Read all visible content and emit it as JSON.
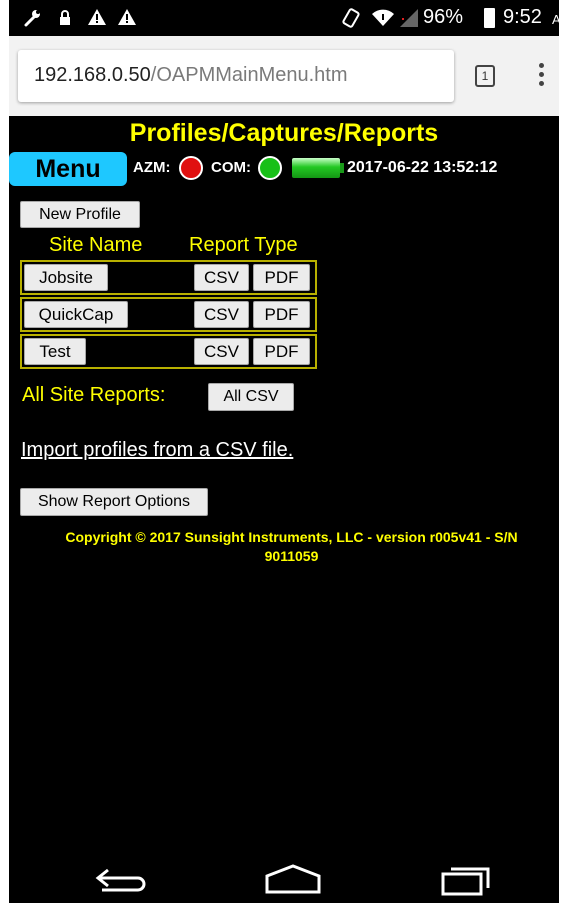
{
  "status_bar": {
    "battery_percent": "96%",
    "time": "9:52",
    "time_suffix": "AM"
  },
  "browser": {
    "url_host": "192.168.0.50",
    "url_path": "/OAPMMainMenu.htm",
    "tab_count": "1"
  },
  "page": {
    "title": "Profiles/Captures/Reports",
    "menu_label": "Menu",
    "azm_label": "AZM:",
    "azm_status_color": "#e01010",
    "com_label": "COM:",
    "com_status_color": "#18c018",
    "datetime": "2017-06-22 13:52:12",
    "new_profile_label": "New Profile",
    "col_site_name": "Site Name",
    "col_report_type": "Report Type",
    "sites": [
      {
        "name": "Jobsite",
        "csv": "CSV",
        "pdf": "PDF"
      },
      {
        "name": "QuickCap",
        "csv": "CSV",
        "pdf": "PDF"
      },
      {
        "name": "Test",
        "csv": "CSV",
        "pdf": "PDF"
      }
    ],
    "all_site_reports_label": "All Site Reports:",
    "all_csv_label": "All CSV",
    "import_link": "Import profiles from a CSV file.",
    "show_report_options_label": "Show Report Options",
    "copyright_line1": "Copyright © 2017 Sunsight Instruments, LLC - version r005v41 - S/N",
    "copyright_line2": "9011059"
  },
  "nav": {
    "back_icon": "back-arrow-icon",
    "home_icon": "home-icon",
    "recents_icon": "recent-apps-icon"
  },
  "colors": {
    "accent_yellow": "#ffff00",
    "menu_blue": "#1ec8ff"
  }
}
